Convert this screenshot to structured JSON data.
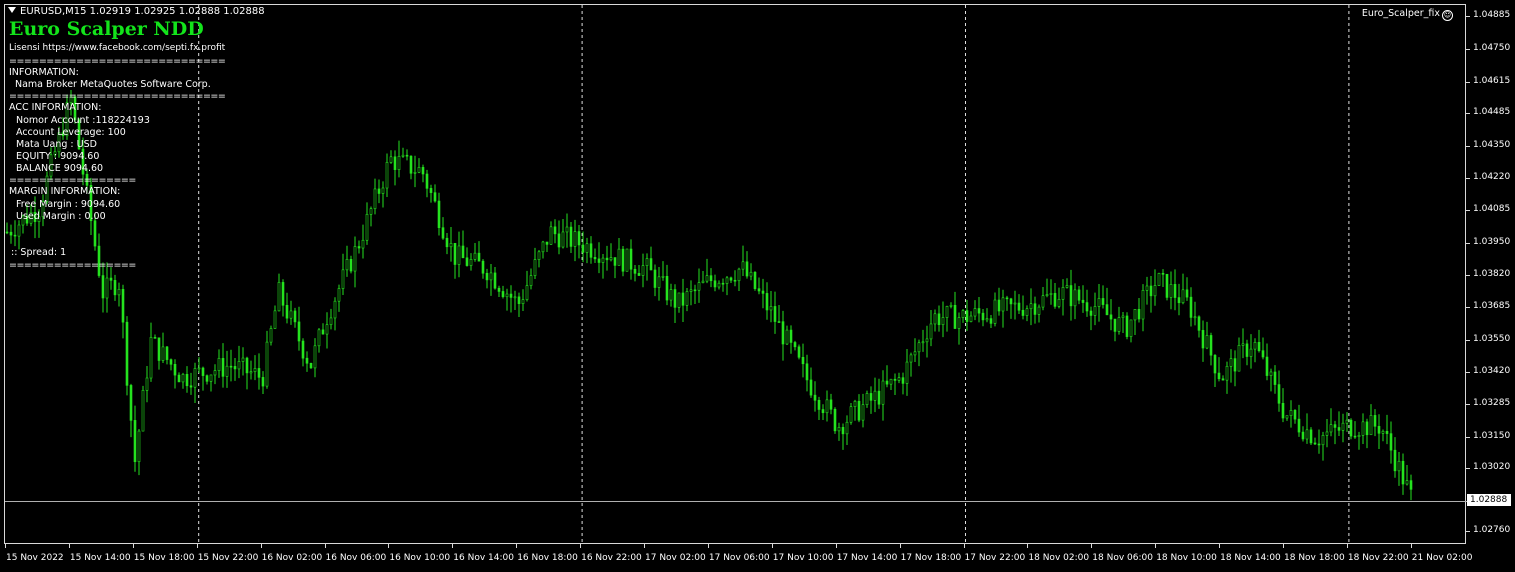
{
  "chart": {
    "symbol_header": "EURUSD,M15  1.02919 1.02925 1.02888 1.02888",
    "ea_name": "Euro_Scalper_fix",
    "ea_icon": "smiley-icon",
    "current_price": "1.02888",
    "candle_color": "#25e21f",
    "background": "#000000"
  },
  "panel": {
    "title": "Euro Scalper NDD",
    "license": "Lisensi https://www.facebook.com/septi.fx.profit",
    "separator_long": "=============================",
    "separator_short": "=================",
    "information_header": "INFORMATION:",
    "broker_name": "Nama Broker MetaQuotes Software Corp.",
    "acc_header": "ACC INFORMATION:",
    "account_number": "Nomor Account :118224193",
    "account_leverage": "Account Leverage: 100",
    "currency": "Mata Uang : USD",
    "equity": "EQUITY : 9094.60",
    "balance": "BALANCE 9094.60",
    "margin_header": "MARGIN INFORMATION:",
    "free_margin": "Free Margin : 9094.60",
    "used_margin": "Used Margin : 0.00",
    "spread": ":: Spread: 1"
  },
  "price_axis": [
    "1.04885",
    "1.04750",
    "1.04615",
    "1.04485",
    "1.04350",
    "1.04220",
    "1.04085",
    "1.03950",
    "1.03820",
    "1.03685",
    "1.03550",
    "1.03420",
    "1.03285",
    "1.03150",
    "1.03020",
    "1.02760"
  ],
  "time_axis": [
    "15 Nov 2022",
    "15 Nov 14:00",
    "15 Nov 18:00",
    "15 Nov 22:00",
    "16 Nov 02:00",
    "16 Nov 06:00",
    "16 Nov 10:00",
    "16 Nov 14:00",
    "16 Nov 18:00",
    "16 Nov 22:00",
    "17 Nov 02:00",
    "17 Nov 06:00",
    "17 Nov 10:00",
    "17 Nov 14:00",
    "17 Nov 18:00",
    "17 Nov 22:00",
    "18 Nov 02:00",
    "18 Nov 06:00",
    "18 Nov 10:00",
    "18 Nov 14:00",
    "18 Nov 18:00",
    "18 Nov 22:00",
    "21 Nov 02:00"
  ],
  "chart_data": {
    "type": "candlestick",
    "symbol": "EURUSD",
    "timeframe": "M15",
    "ylim": [
      1.027,
      1.0492
    ],
    "day_separators": [
      "15 Nov 22:00",
      "16 Nov 22:00",
      "17 Nov 22:00",
      "18 Nov 22:00"
    ],
    "current_price": 1.02888,
    "close_path": [
      [
        "15 Nov 10:00",
        1.04
      ],
      [
        "15 Nov 12:00",
        1.041
      ],
      [
        "15 Nov 14:00",
        1.0455
      ],
      [
        "15 Nov 16:00",
        1.0375
      ],
      [
        "15 Nov 17:00",
        1.038
      ],
      [
        "15 Nov 18:00",
        1.0305
      ],
      [
        "15 Nov 19:00",
        1.0355
      ],
      [
        "15 Nov 21:00",
        1.034
      ],
      [
        "16 Nov 00:00",
        1.0345
      ],
      [
        "16 Nov 02:00",
        1.034
      ],
      [
        "16 Nov 03:00",
        1.0375
      ],
      [
        "16 Nov 05:00",
        1.0345
      ],
      [
        "16 Nov 06:00",
        1.0365
      ],
      [
        "16 Nov 08:00",
        1.0395
      ],
      [
        "16 Nov 10:00",
        1.043
      ],
      [
        "16 Nov 12:00",
        1.0425
      ],
      [
        "16 Nov 14:00",
        1.039
      ],
      [
        "16 Nov 16:00",
        1.0385
      ],
      [
        "16 Nov 18:00",
        1.037
      ],
      [
        "16 Nov 20:00",
        1.04
      ],
      [
        "16 Nov 22:00",
        1.0395
      ],
      [
        "17 Nov 02:00",
        1.0385
      ],
      [
        "17 Nov 04:00",
        1.037
      ],
      [
        "17 Nov 06:00",
        1.038
      ],
      [
        "17 Nov 08:00",
        1.0385
      ],
      [
        "17 Nov 10:00",
        1.0365
      ],
      [
        "17 Nov 12:00",
        1.034
      ],
      [
        "17 Nov 14:00",
        1.032
      ],
      [
        "17 Nov 16:00",
        1.033
      ],
      [
        "17 Nov 18:00",
        1.034
      ],
      [
        "17 Nov 20:00",
        1.0365
      ],
      [
        "17 Nov 22:00",
        1.0365
      ],
      [
        "18 Nov 02:00",
        1.037
      ],
      [
        "18 Nov 04:00",
        1.0375
      ],
      [
        "18 Nov 06:00",
        1.037
      ],
      [
        "18 Nov 08:00",
        1.036
      ],
      [
        "18 Nov 10:00",
        1.038
      ],
      [
        "18 Nov 12:00",
        1.037
      ],
      [
        "18 Nov 14:00",
        1.034
      ],
      [
        "18 Nov 16:00",
        1.0355
      ],
      [
        "18 Nov 18:00",
        1.0325
      ],
      [
        "18 Nov 20:00",
        1.0315
      ],
      [
        "18 Nov 22:00",
        1.032
      ],
      [
        "21 Nov 00:00",
        1.032
      ],
      [
        "21 Nov 02:00",
        1.0289
      ]
    ]
  }
}
